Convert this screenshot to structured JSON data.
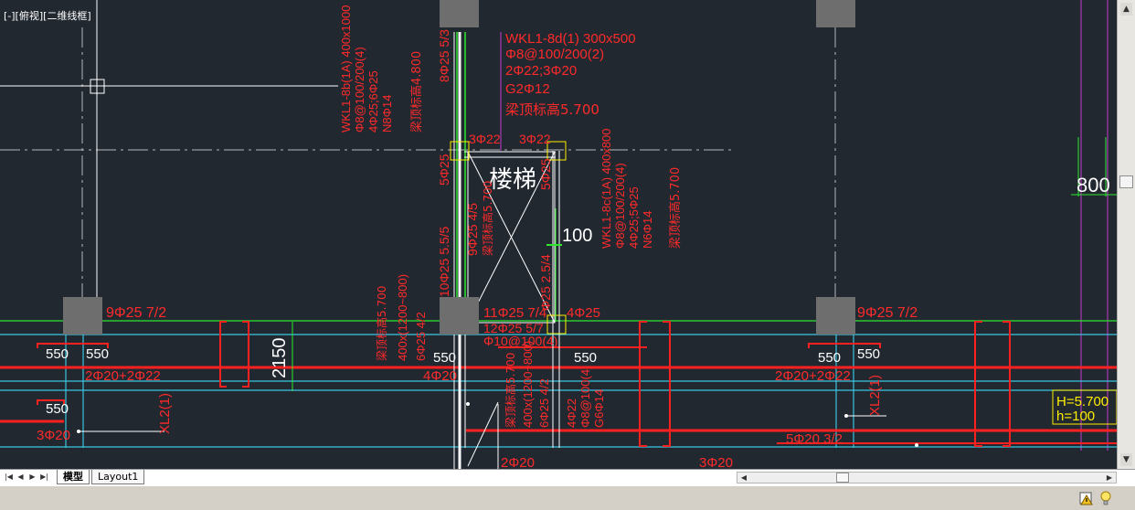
{
  "viewport": {
    "label": "[-][俯视][二维线框]",
    "texts": {
      "stair": "楼梯",
      "beam_wkl_8d": "WKL1-8d(1) 300x500",
      "beam_wkl_8d_stirrup": "Φ8@100/200(2)",
      "beam_wkl_8d_rebar": "2Φ22;3Φ20",
      "beam_wkl_8d_g": "G2Φ12",
      "beam_wkl_8d_elev": "梁顶标高5.700",
      "beam_wkl_8b": "WKL1-8b(1A) 400x1000",
      "beam_wkl_8b_stirrup": "Φ8@100/200(4)",
      "beam_wkl_8b_rebar": "4Φ25;6Φ25",
      "beam_wkl_8b_n": "N8Φ14",
      "beam_wkl_8b_elev": "梁顶标高4.800",
      "beam_wkl_8c": "WKL1-8c(1A) 400x800",
      "beam_wkl_8c_stirrup": "Φ8@100/200(4)",
      "beam_wkl_8c_rebar": "4Φ25;5Φ25",
      "beam_wkl_8c_n": "N6Φ14",
      "beam_wkl_8c_elev": "梁顶标高5.700",
      "rebar_8_25": "8Φ25 5/3",
      "rebar_3_22_a": "3Φ22",
      "rebar_3_22_b": "3Φ22",
      "rebar_5_25_left": "5Φ25",
      "rebar_5_25_right": "5Φ25",
      "rebar_9_25_45": "9Φ25 4/5",
      "rebar_elev_side": "梁顶标高5.700",
      "rebar_10_25": "10Φ25 5.5/5",
      "rebar_side_2_5_4": "Φ25 2.5/4",
      "dim_100": "100",
      "dim_800": "800",
      "dim_2150": "2150",
      "rebar_9_25_72_left": "9Φ25 7/2",
      "rebar_9_25_72_right": "9Φ25 7/2",
      "rebar_11_25": "11Φ25 7/4",
      "rebar_4_25": "4Φ25",
      "rebar_12_25": "12Φ25 5/7",
      "rebar_stirrup_10": "Φ10@100(4)",
      "dim_550_1": "550",
      "dim_550_2": "550",
      "dim_550_3": "550",
      "dim_550_4": "550",
      "dim_550_5": "550",
      "dim_550_6": "550",
      "dim_550_7": "550",
      "rebar_2_20_2_22_left": "2Φ20+2Φ22",
      "rebar_2_20_2_22_right": "2Φ20+2Φ22",
      "rebar_3_20_left": "3Φ20",
      "rebar_3_20_right": "3Φ20",
      "rebar_2_20": "2Φ20",
      "rebar_5_20": "5Φ20 3/2",
      "beam_mid_elev": "梁顶标高5.700",
      "beam_mid_size": "400x(1200~800)",
      "beam_mid_rebar": "6Φ25 4/2",
      "beam_mid_4_20": "4Φ20",
      "beam_low_elev": "梁顶标高5.700",
      "beam_low_size": "400x(1200~800)",
      "beam_low_rebar": "6Φ25 4/2",
      "beam_low_4_22": "4Φ22",
      "beam_low_stirrup": "Φ8@100(4)",
      "beam_low_g": "G6Φ14",
      "xl_left": "XL2(1)",
      "xl_right": "XL2(1)",
      "h_upper": "H=5.700",
      "h_lower": "h=100"
    }
  },
  "tabs": [
    {
      "label": "模型",
      "active": true
    },
    {
      "label": "Layout1",
      "active": false
    }
  ],
  "nav": {
    "first": "|◀",
    "prev": "◀",
    "next": "▶",
    "last": "▶|"
  },
  "scroll": {
    "up": "▲",
    "down": "▼",
    "left": "◀",
    "right": "▶"
  },
  "status_icons": [
    "drawing-status-icon",
    "lightbulb-icon"
  ],
  "colors": {
    "background": "#212830",
    "rebar_text": "#ff2a2a",
    "grid_line": "#ffffff",
    "cyan_line": "#39c6e0",
    "green_line": "#2ee62e",
    "magenta_line": "#c23bd1",
    "column": "#6e6e6e",
    "node": "#ffee00"
  }
}
